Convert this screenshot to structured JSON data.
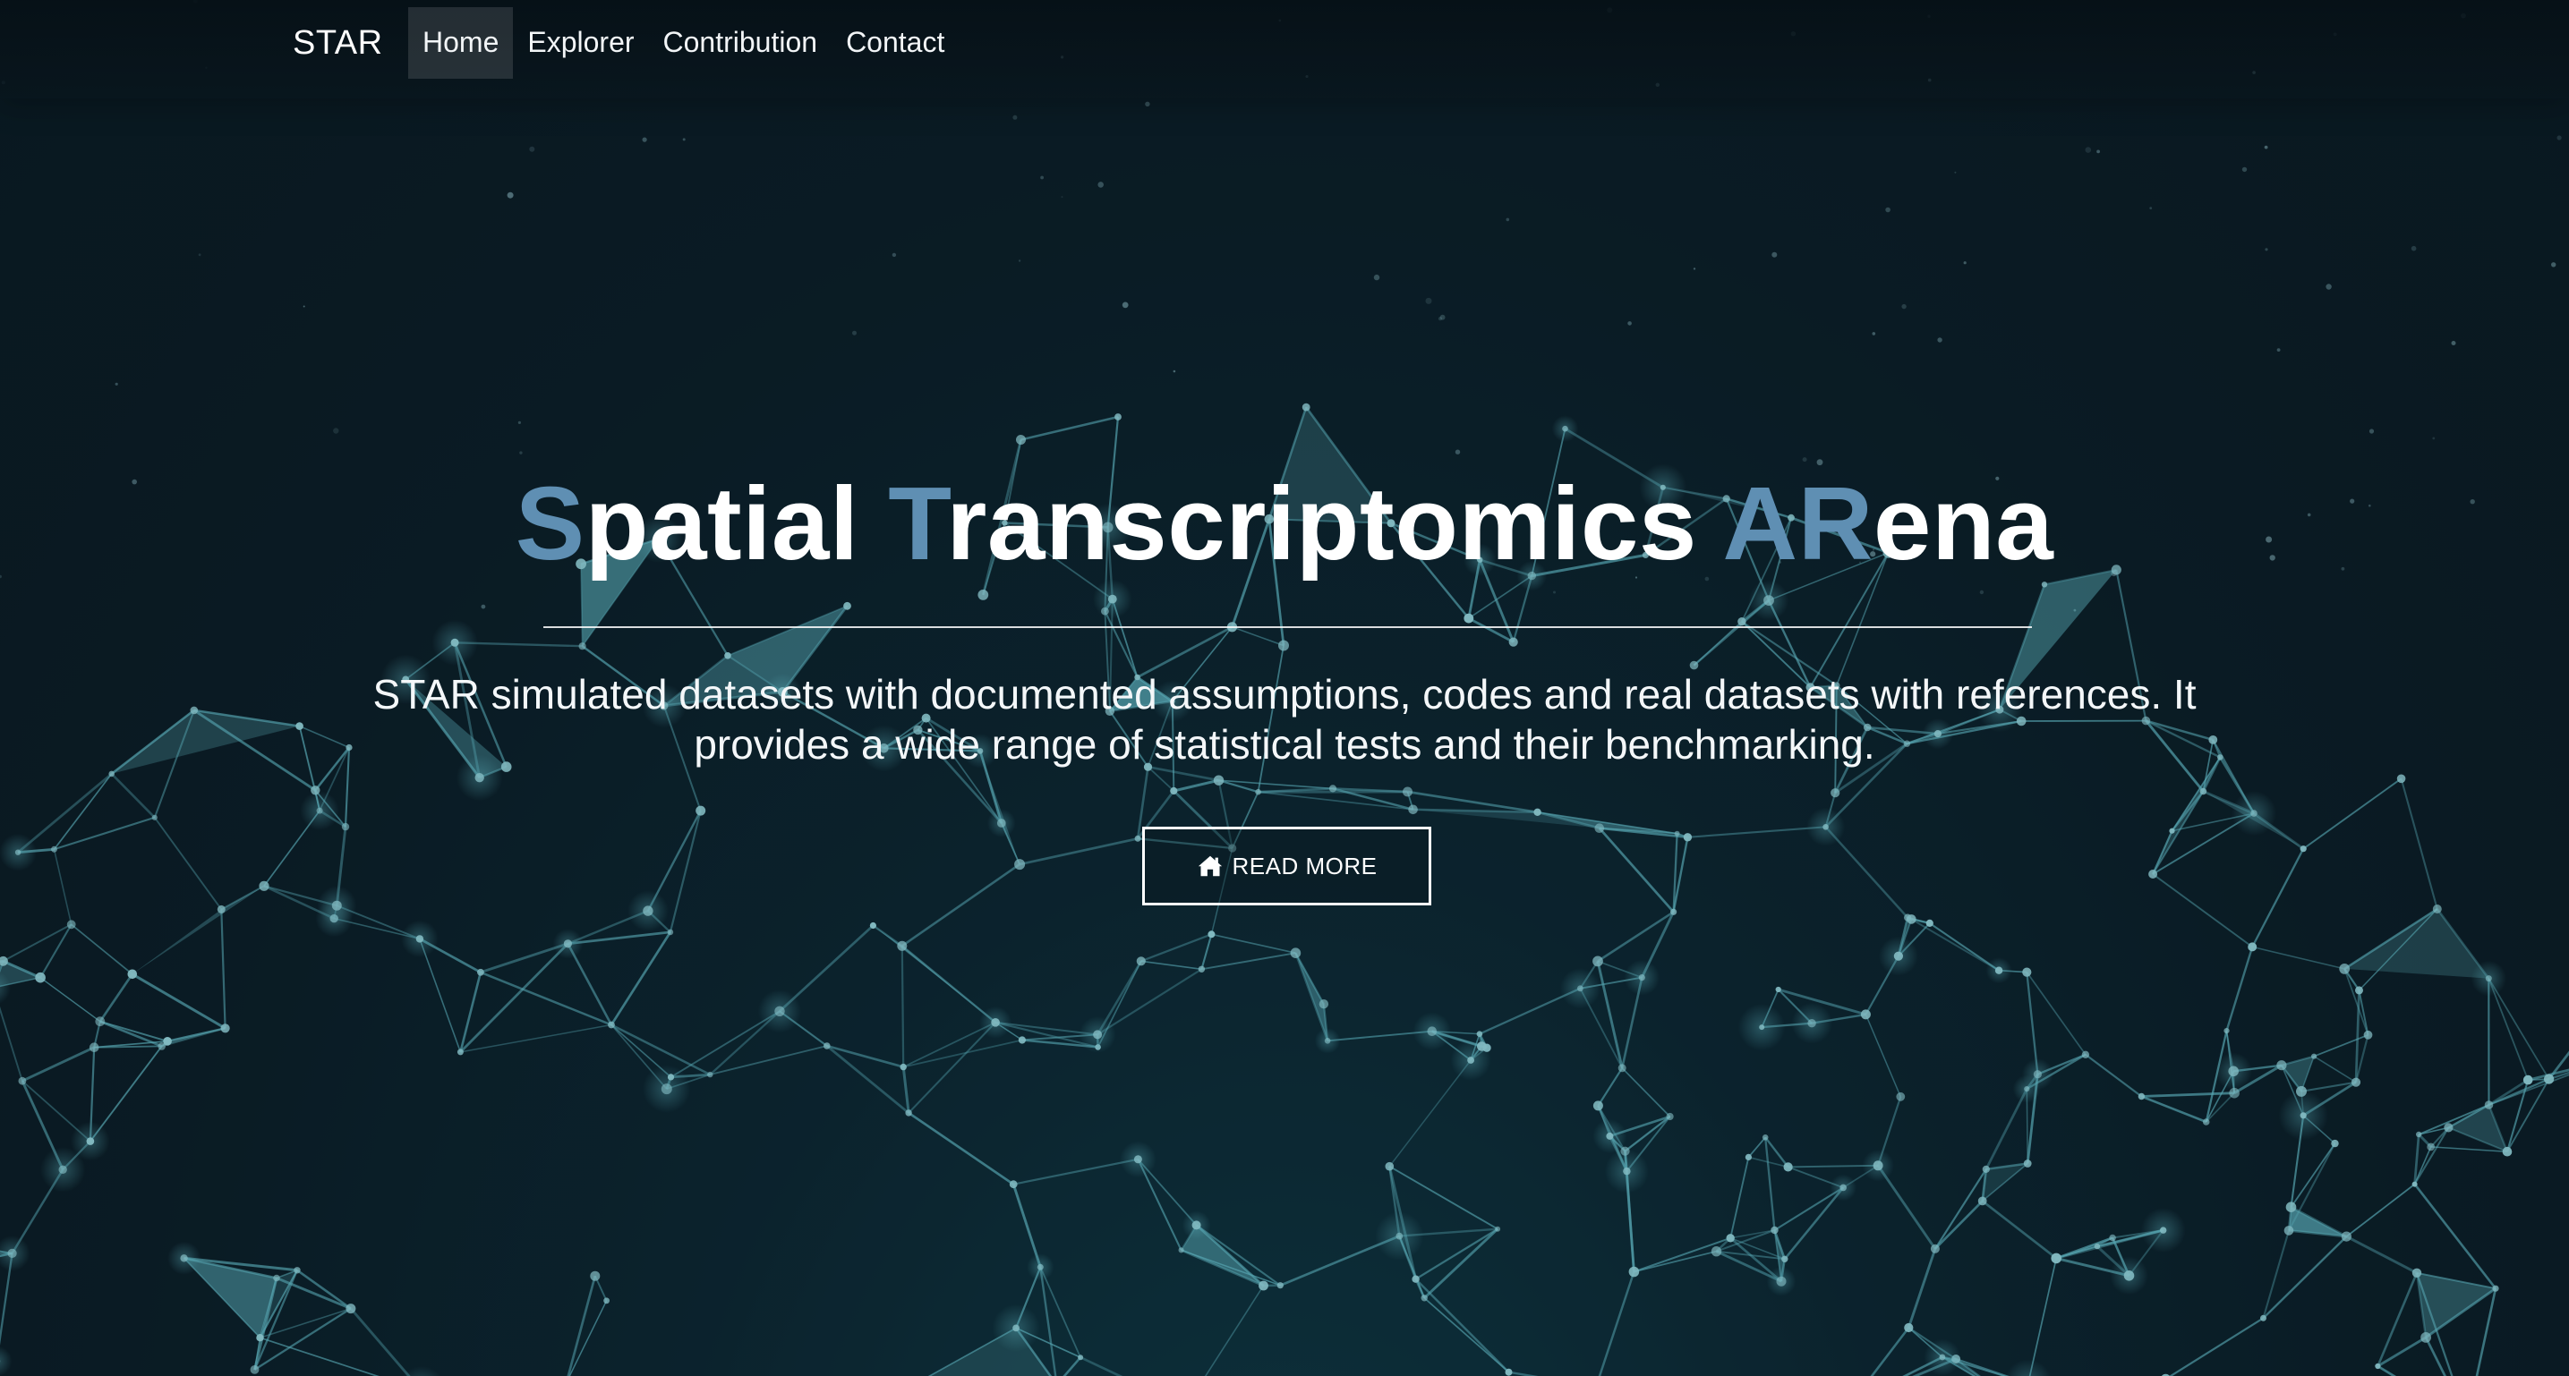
{
  "navbar": {
    "brand": "STAR",
    "links": [
      {
        "label": "Home",
        "active": true
      },
      {
        "label": "Explorer",
        "active": false
      },
      {
        "label": "Contribution",
        "active": false
      },
      {
        "label": "Contact",
        "active": false
      }
    ]
  },
  "hero": {
    "title_parts": [
      {
        "text": "S",
        "highlight": true
      },
      {
        "text": "patial ",
        "highlight": false
      },
      {
        "text": "T",
        "highlight": true
      },
      {
        "text": "ranscriptomics ",
        "highlight": false
      },
      {
        "text": "AR",
        "highlight": true
      },
      {
        "text": "ena",
        "highlight": false
      }
    ],
    "description": "STAR simulated datasets with documented assumptions, codes and real datasets with references. It provides a wide range of statistical tests and their benchmarking.",
    "button_label": "READ MORE",
    "button_icon": "home-icon"
  },
  "colors": {
    "background": "#0b1a22",
    "highlight": "#5f8fb3",
    "network": "#6fd3e0"
  }
}
